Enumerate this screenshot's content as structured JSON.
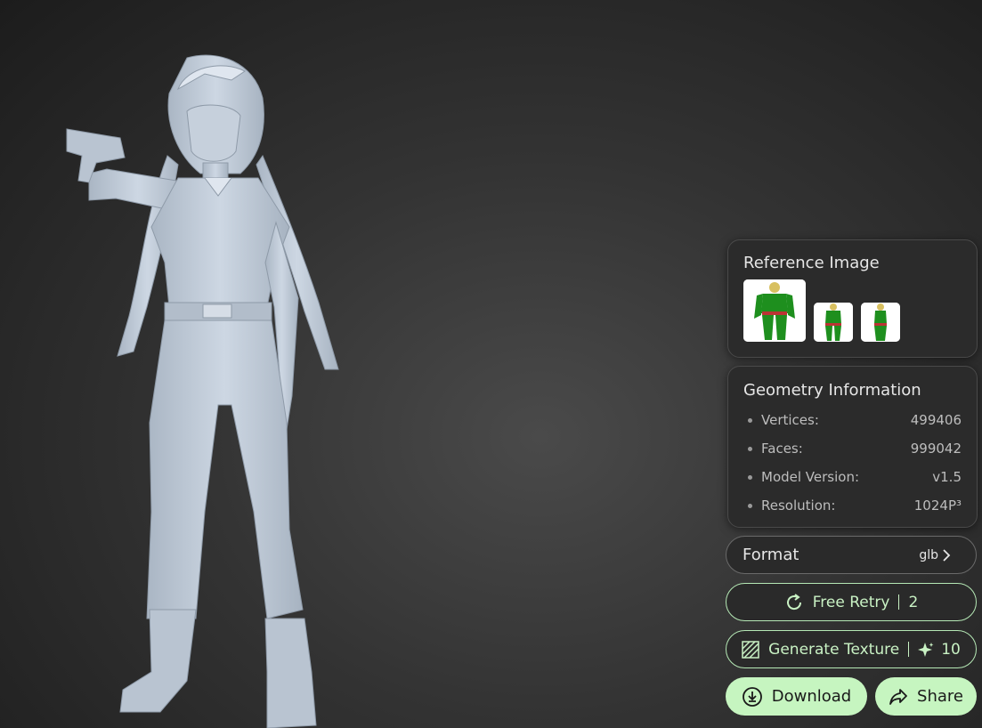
{
  "reference": {
    "title": "Reference Image",
    "thumbnails": [
      "front-view",
      "back-view",
      "side-view"
    ]
  },
  "geometry": {
    "title": "Geometry Information",
    "rows": [
      {
        "label": "Vertices:",
        "value": "499406"
      },
      {
        "label": "Faces:",
        "value": "999042"
      },
      {
        "label": "Model Version:",
        "value": "v1.5"
      },
      {
        "label": "Resolution:",
        "value": "1024P³"
      }
    ]
  },
  "format": {
    "label": "Format",
    "value": "glb"
  },
  "retry": {
    "label": "Free Retry",
    "count": "2",
    "icon": "refresh-icon"
  },
  "texture": {
    "label": "Generate Texture",
    "count": "10",
    "icon": "texture-icon",
    "credit_icon": "sparkle-icon"
  },
  "download": {
    "label": "Download",
    "icon": "download-icon"
  },
  "share": {
    "label": "Share",
    "icon": "share-icon"
  },
  "colors": {
    "accent": "#c6f5c0",
    "model": "#c3cedb",
    "panel": "#2b2b2b",
    "thumb_green": "#1e8f1e"
  }
}
